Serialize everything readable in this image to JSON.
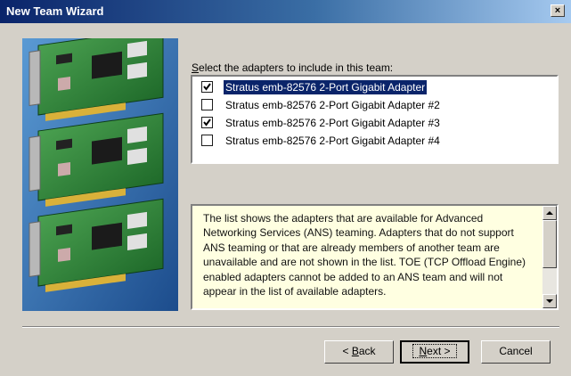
{
  "window": {
    "title": "New Team Wizard",
    "close_label": "×"
  },
  "prompt": {
    "accel": "S",
    "rest": "elect the adapters to include in this team:"
  },
  "adapters": [
    {
      "label": "Stratus emb-82576 2-Port Gigabit Adapter",
      "checked": true,
      "selected": true
    },
    {
      "label": "Stratus emb-82576 2-Port Gigabit Adapter #2",
      "checked": false,
      "selected": false
    },
    {
      "label": "Stratus emb-82576 2-Port Gigabit Adapter #3",
      "checked": true,
      "selected": false
    },
    {
      "label": "Stratus emb-82576 2-Port Gigabit Adapter #4",
      "checked": false,
      "selected": false
    }
  ],
  "info": {
    "text": "The list shows the adapters that are available for Advanced Networking Services (ANS) teaming. Adapters that do not support ANS teaming or that are already members of another team are unavailable and are not shown in the list. TOE (TCP Offload Engine) enabled adapters cannot be added to an ANS team and will not appear in the list of available adapters."
  },
  "buttons": {
    "back": {
      "prefix": "< ",
      "accel": "B",
      "rest": "ack"
    },
    "next": {
      "accel": "N",
      "rest": "ext >"
    },
    "cancel": {
      "label": "Cancel"
    }
  },
  "colors": {
    "title_gradient_start": "#0a246a",
    "title_gradient_end": "#a6caf0",
    "dialog_bg": "#d4d0c8",
    "info_bg": "#ffffe1",
    "selection_bg": "#0a246a"
  },
  "icons": {
    "art": "stacked-network-adapter-cards-image",
    "close": "close-icon",
    "check": "check-mark-icon",
    "scroll_up": "scroll-up-arrow-icon",
    "scroll_down": "scroll-down-arrow-icon"
  }
}
